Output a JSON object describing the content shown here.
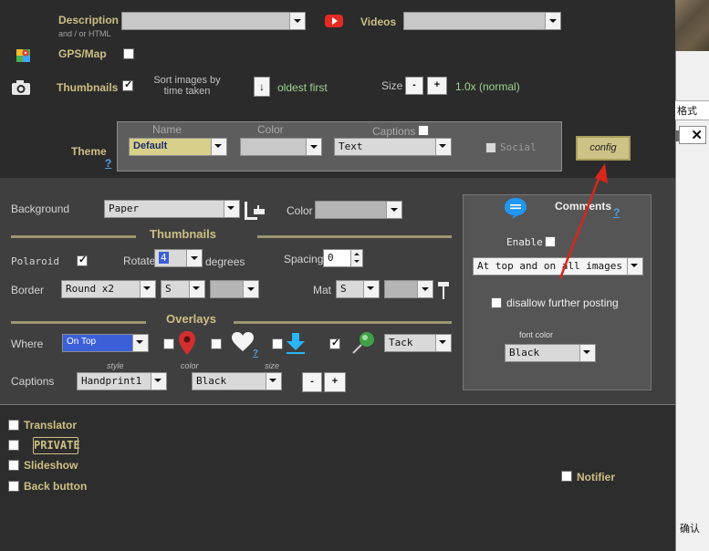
{
  "top": {
    "description_label": "Description",
    "description_sub": "and / or HTML",
    "videos_label": "Videos",
    "gps_label": "GPS/Map",
    "thumbnails_label": "Thumbnails",
    "sort_label": "Sort images by time taken",
    "sort_btn": "↓",
    "sort_value": "oldest first",
    "size_label": "Size",
    "size_minus": "-",
    "size_plus": "+",
    "size_value": "1.0x (normal)"
  },
  "theme": {
    "label": "Theme",
    "help": "?",
    "name_label": "Name",
    "color_label": "Color",
    "captions_label": "Captions",
    "name_value": "Default",
    "captions_value": "Text",
    "social_label": "Social",
    "config_label": "config"
  },
  "mid": {
    "background_label": "Background",
    "background_value": "Paper",
    "color_label": "Color",
    "thumbnails_header": "Thumbnails",
    "polaroid_label": "Polaroid",
    "rotate_label": "Rotate",
    "rotate_value": "4",
    "degrees_label": "degrees",
    "spacing_label": "Spacing",
    "spacing_value": "0",
    "border_label": "Border",
    "border_value": "Round x2",
    "border_size": "S",
    "mat_label": "Mat",
    "mat_size": "S",
    "overlays_header": "Overlays",
    "where_label": "Where",
    "where_value": "On Top",
    "overlay_help": "?",
    "tack_value": "Tack",
    "captions_label": "Captions",
    "style_label": "style",
    "color_small": "color",
    "size_small": "size",
    "caption_style": "Handprint1",
    "caption_color": "Black",
    "cap_minus": "-",
    "cap_plus": "+"
  },
  "comments": {
    "title": "Comments",
    "help": "?",
    "enable_label": "Enable",
    "position_value": "At top and on all images",
    "disallow_label": "disallow further posting",
    "font_color_label": "font color",
    "font_color_value": "Black"
  },
  "bottom": {
    "translator_label": "Translator",
    "private_label": "PRIVATE",
    "slideshow_label": "Slideshow",
    "back_label": "Back button",
    "notifier_label": "Notifier"
  },
  "sidebar": {
    "text1": "格式",
    "text2": "确认"
  },
  "colors": {
    "accent_gold": "#cdbf84",
    "arrow_red": "#d9261c",
    "link_blue": "#4ea0e6"
  }
}
